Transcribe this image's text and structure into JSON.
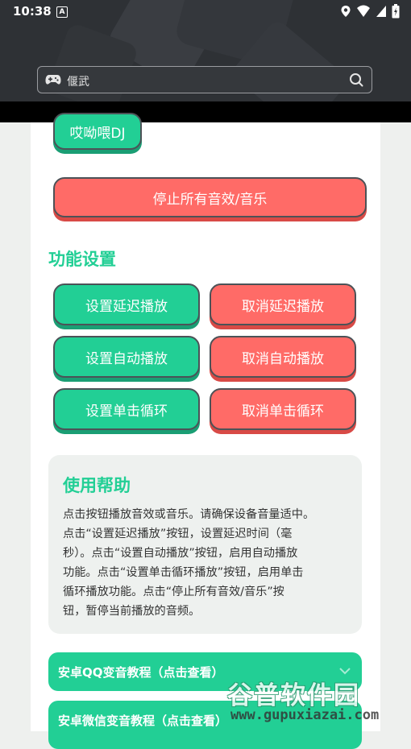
{
  "status_bar": {
    "time": "10:38",
    "notification": "A"
  },
  "search": {
    "value": "偃武"
  },
  "buttons": {
    "partial_top": "哎呦喂DJ",
    "stop_all": "停止所有音效/音乐"
  },
  "settings": {
    "title": "功能设置",
    "set_delay": "设置延迟播放",
    "cancel_delay": "取消延迟播放",
    "set_auto": "设置自动播放",
    "cancel_auto": "取消自动播放",
    "set_loop": "设置单击循环",
    "cancel_loop": "取消单击循环"
  },
  "help": {
    "title": "使用帮助",
    "lines": [
      "点击按钮播放音效或音乐。请确保设备音量适中。",
      "点击“设置延迟播放”按钮，设置延迟时间（毫",
      "秒）。点击“设置自动播放”按钮，启用自动播放",
      "功能。点击“设置单击循环播放”按钮，启用单击",
      "循环播放功能。点击“停止所有音效/音乐”按",
      "钮，暂停当前播放的音频。"
    ]
  },
  "tutorials": [
    {
      "label": "安卓QQ变音教程（点击查看）"
    },
    {
      "label": "安卓微信变音教程（点击查看）"
    }
  ],
  "watermark": {
    "name": "谷普软件园",
    "url": "www.gupuxiazai.com"
  },
  "colors": {
    "accent_green": "#22cf95",
    "accent_red": "#ff6b67",
    "header_bg": "#2e3135"
  }
}
